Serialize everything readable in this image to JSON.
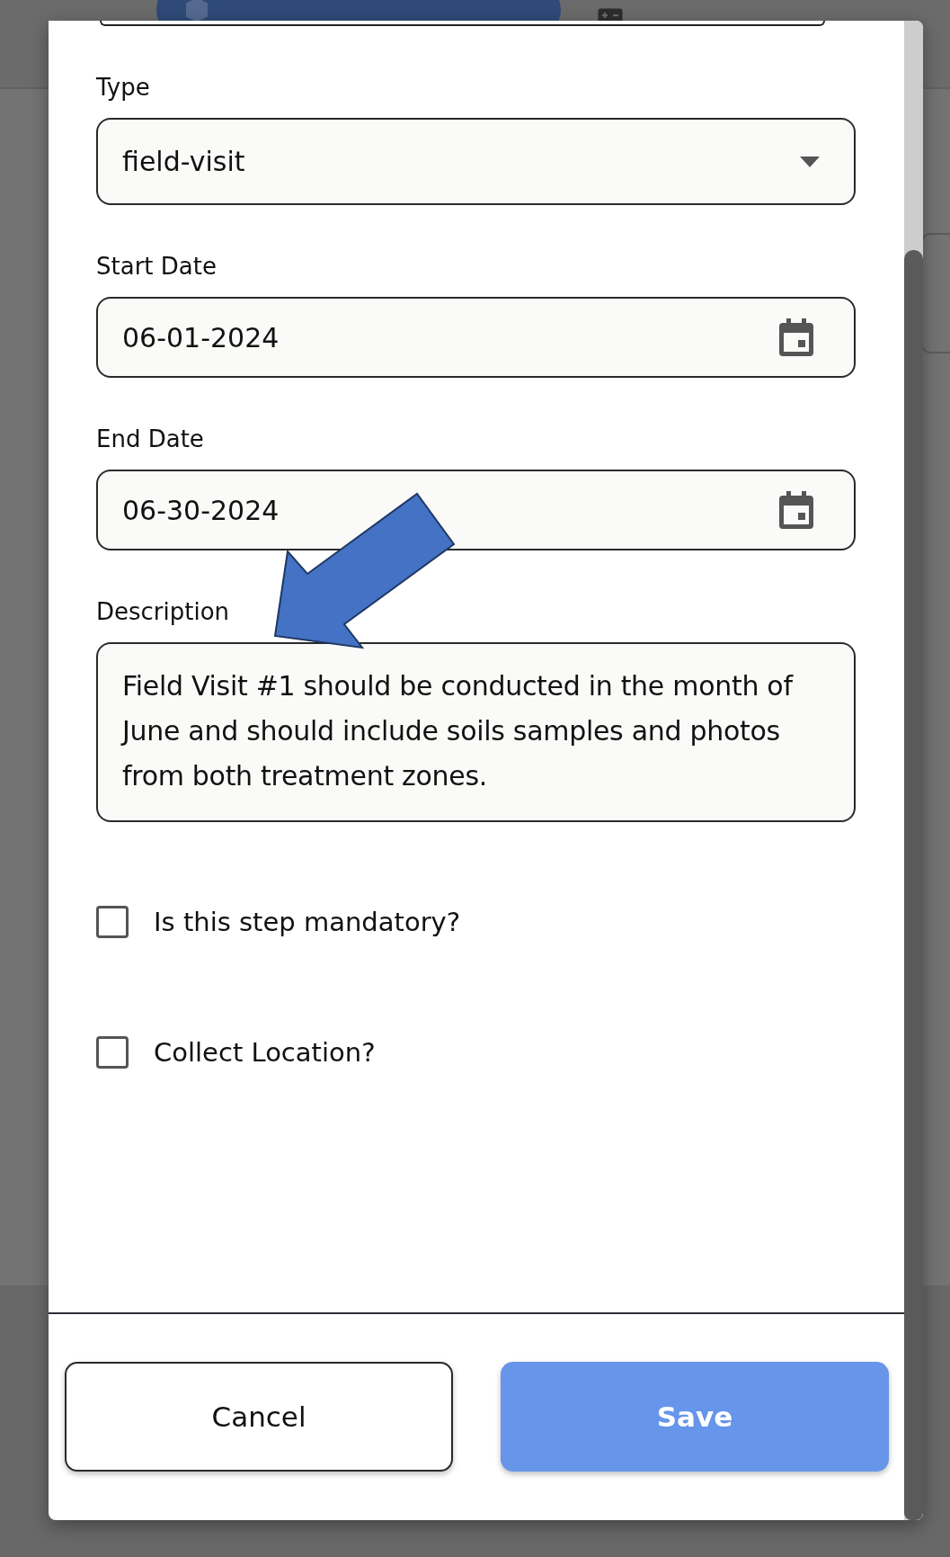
{
  "dialog": {
    "fields": [
      {
        "kind": "select",
        "label": "Type",
        "value": "field-visit"
      },
      {
        "kind": "date",
        "label": "Start Date",
        "value": "06-01-2024"
      },
      {
        "kind": "date",
        "label": "End Date",
        "value": "06-30-2024"
      },
      {
        "kind": "textarea",
        "label": "Description",
        "value": "Field Visit #1 should be conducted in the month of June and should include soils samples and photos from both treatment zones."
      }
    ],
    "checkboxes": [
      {
        "label": "Is this step mandatory?",
        "checked": false
      },
      {
        "label": "Collect Location?",
        "checked": false
      }
    ],
    "buttons": [
      {
        "label": "Cancel",
        "kind": "secondary"
      },
      {
        "label": "Save",
        "kind": "primary"
      }
    ]
  }
}
